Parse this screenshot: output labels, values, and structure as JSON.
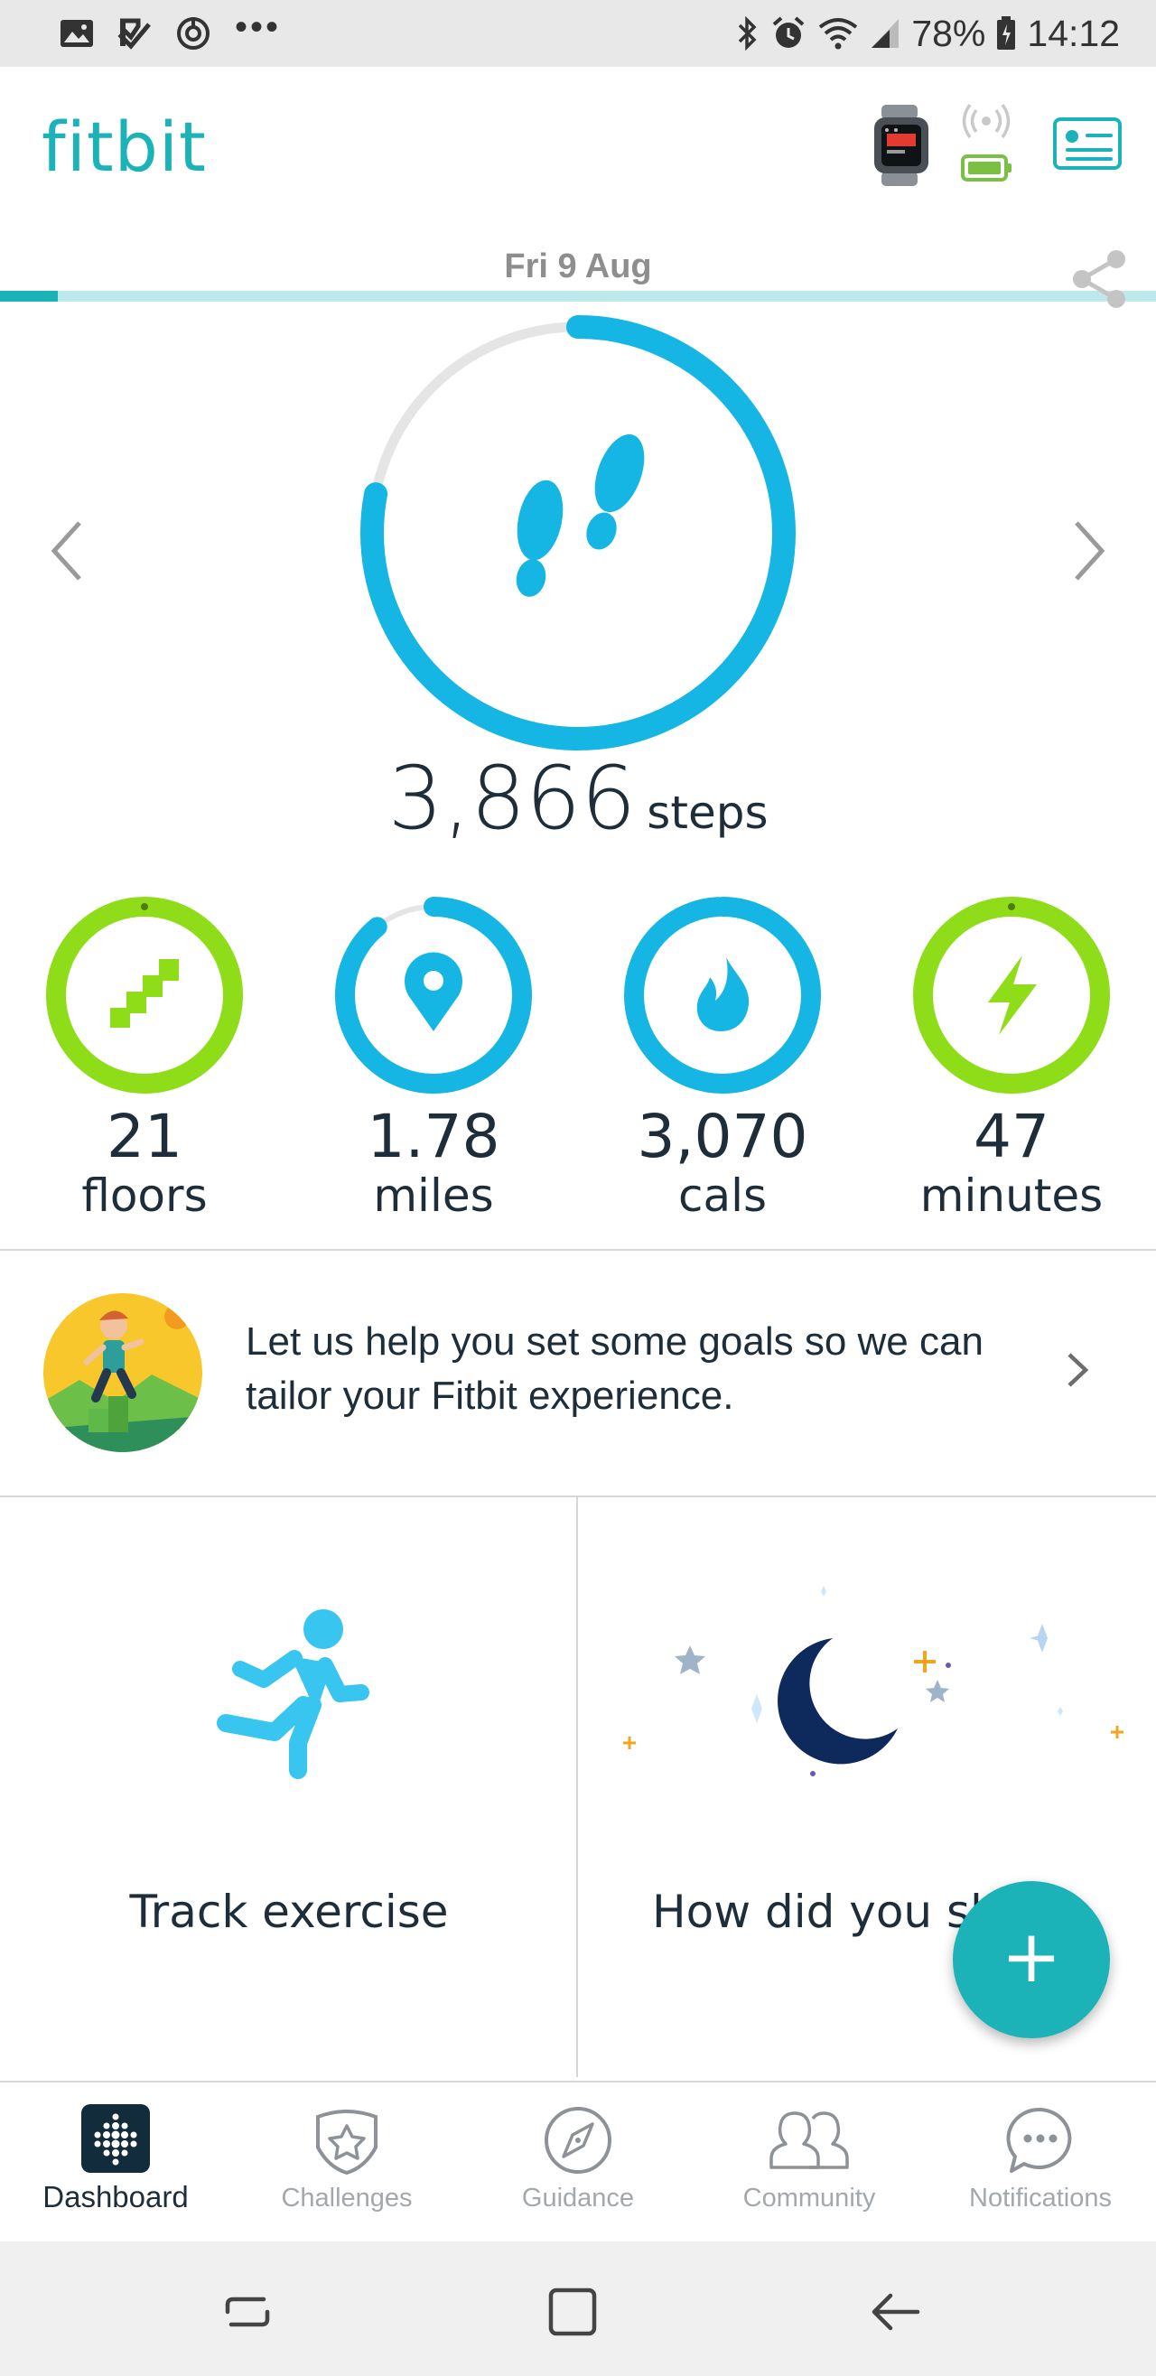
{
  "status_bar": {
    "battery_percent": "78%",
    "time": "14:12",
    "icons": [
      "image-icon",
      "checklist-icon",
      "sync-circle-icon",
      "more-dots-icon",
      "bluetooth-icon",
      "alarm-icon",
      "wifi-icon",
      "signal-icon",
      "battery-icon"
    ],
    "more": "•••"
  },
  "header": {
    "logo": "fitbit",
    "icons": [
      "watch-device-icon",
      "sync-signal-icon",
      "device-battery-icon",
      "profile-card-icon"
    ],
    "goal_progress": 0.05
  },
  "dashboard": {
    "date": "Fri 9 Aug",
    "steps": {
      "value": "3,866",
      "unit": "steps",
      "progress": 0.78
    },
    "stats": [
      {
        "value": "21",
        "unit": "floors",
        "icon": "stairs-icon",
        "color": "#8fdd18",
        "progress": 1.0
      },
      {
        "value": "1.78",
        "unit": "miles",
        "icon": "location-pin-icon",
        "color": "#16b6e4",
        "progress": 0.89
      },
      {
        "value": "3,070",
        "unit": "cals",
        "icon": "flame-icon",
        "color": "#16b6e4",
        "progress": 0.99
      },
      {
        "value": "47",
        "unit": "minutes",
        "icon": "lightning-icon",
        "color": "#8fdd18",
        "progress": 1.0
      }
    ]
  },
  "goals_banner": {
    "text": "Let us help you set some goals so we can tailor your Fitbit experience."
  },
  "tiles": {
    "exercise_label": "Track exercise",
    "sleep_label": "How did you sl"
  },
  "fab": {
    "label": "+"
  },
  "bottom_nav": [
    {
      "label": "Dashboard",
      "icon": "dashboard-grid-icon",
      "active": true
    },
    {
      "label": "Challenges",
      "icon": "challenges-star-icon",
      "active": false
    },
    {
      "label": "Guidance",
      "icon": "compass-icon",
      "active": false
    },
    {
      "label": "Community",
      "icon": "people-icon",
      "active": false
    },
    {
      "label": "Notifications",
      "icon": "chat-bubble-icon",
      "active": false
    }
  ],
  "colors": {
    "brand": "#1bb3b8",
    "steps_ring": "#16b6e4",
    "active_ring": "#8fdd18"
  }
}
